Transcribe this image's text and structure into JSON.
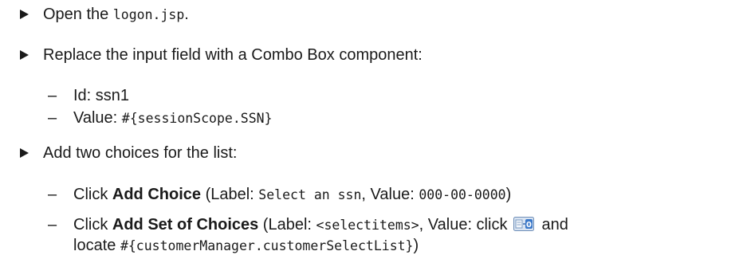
{
  "steps": [
    {
      "pre": "Open the ",
      "code": "logon.jsp",
      "post": "."
    },
    {
      "text": "Replace the input field with a Combo Box component:"
    },
    {
      "text": "Add two choices for the list:"
    }
  ],
  "props": [
    {
      "label": "Id: ssn1"
    },
    {
      "label": "Value: ",
      "code": "#{sessionScope.SSN}"
    }
  ],
  "choices": [
    {
      "pre": "Click ",
      "bold": "Add Choice",
      "mid1": " (Label: ",
      "code1": "Select an ssn",
      "mid2": ", Value: ",
      "code2": "000-00-0000",
      "post": ")"
    },
    {
      "pre": "Click ",
      "bold": "Add Set of Choices",
      "mid1": " (Label: ",
      "code1": "<selectitems>",
      "mid2": ", Value: click ",
      "post": " and",
      "line2_pre": "locate ",
      "line2_code": "#{customerManager.customerSelectList}",
      "line2_post": ")"
    }
  ],
  "dash": "–",
  "icons": {
    "bind_button": "databind-icon",
    "bullet": "triangle-bullet-icon"
  }
}
